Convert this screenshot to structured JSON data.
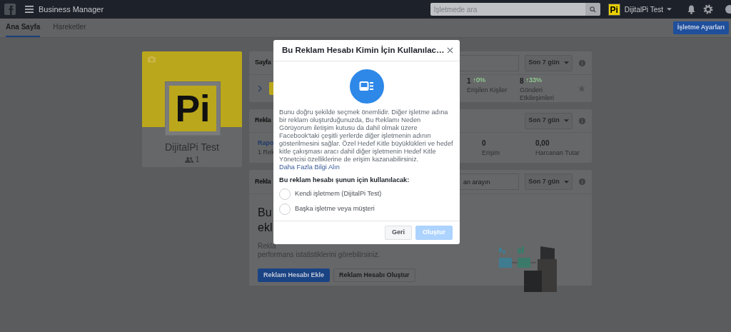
{
  "header": {
    "app_title": "Business Manager",
    "search": {
      "placeholder": "İşletmede ara"
    },
    "account": {
      "logo_text": "Pi",
      "name": "DijitalPi Test"
    }
  },
  "tabs": [
    {
      "label": "Ana Sayfa",
      "selected": true
    },
    {
      "label": "Hareketler",
      "selected": false
    }
  ],
  "settings_button": "İşletme Ayarları",
  "business_card": {
    "logo_text": "Pi",
    "name": "DijitalPi Test",
    "people_count": "1"
  },
  "pages_panel": {
    "title": "Sayfa",
    "date_range": "Son 7 gün",
    "stats": [
      {
        "value": "1",
        "change": "↑0%",
        "label": "Erişilen Kişiler"
      },
      {
        "value": "8",
        "change": "↑33%",
        "label": "Gönderi Etkileşimleri"
      }
    ]
  },
  "ads_panel": {
    "title": "Rekla",
    "link": "Rapo",
    "subtitle": "1 Rek",
    "date_range": "Son 7 gün",
    "stats": [
      {
        "value": "0",
        "label": "Erişim"
      },
      {
        "value": "0,00",
        "label": "Harcanan Tutar"
      }
    ]
  },
  "accounts_panel": {
    "title": "Rekla",
    "search": {
      "placeholder": "an arayın"
    },
    "date_range": "Son 7 gün",
    "heading_lines": [
      "Bu",
      "ekl"
    ],
    "description_lines": [
      "Rekla",
      "performans istatistiklerini görebilirsiniz."
    ],
    "buttons": [
      {
        "label": "Reklam Hesabı Ekle",
        "kind": "primary"
      },
      {
        "label": "Reklam Hesabı Oluştur",
        "kind": "secondary"
      }
    ]
  },
  "dialog": {
    "title": "Bu Reklam Hesabı Kimin İçin Kullanılac…",
    "body": "Bunu doğru şekilde seçmek önemlidir. Diğer işletme adına bir reklam oluşturduğunuzda, Bu Reklamı Neden Görüyorum iletişim kutusu da dahil olmak üzere Facebook'taki çeşitli yerlerde diğer işletmenin adının gösterilmesini sağlar. Özel Hedef Kitle büyüklükleri ve hedef kitle çakışması aracı dahil diğer işletmenin Hedef Kitle Yönetcisi özelliklerine de erişim kazanabilirsiniz.",
    "link": "Daha Fazla Bilgi Alın",
    "question": "Bu reklam hesabı şunun için kullanılacak:",
    "options": [
      {
        "label": "Kendi işletmem (DijitalPi Test)",
        "selected": false
      },
      {
        "label": "Başka işletme veya müşteri",
        "selected": false
      }
    ],
    "buttons": [
      {
        "label": "Geri",
        "disabled": false
      },
      {
        "label": "Oluştur",
        "disabled": true
      }
    ]
  }
}
